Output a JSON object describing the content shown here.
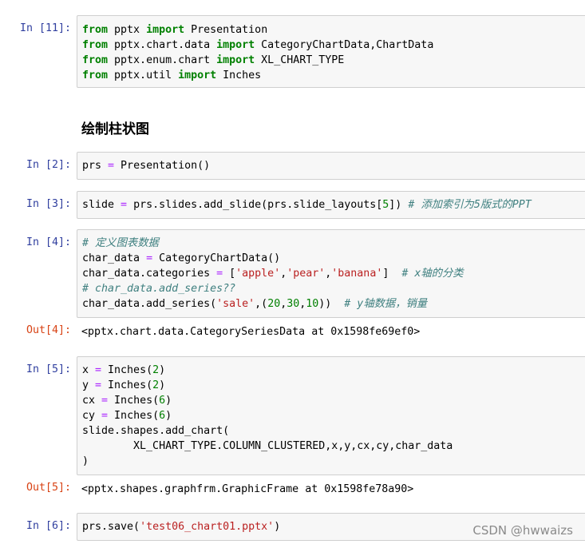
{
  "cells": {
    "c11": {
      "prompt": "In  [11]:"
    },
    "c2": {
      "prompt": "In  [2]:"
    },
    "c3": {
      "prompt": "In  [3]:"
    },
    "c4": {
      "prompt": "In  [4]:",
      "out_prompt": "Out[4]:",
      "output": "<pptx.chart.data.CategorySeriesData at 0x1598fe69ef0>"
    },
    "c5": {
      "prompt": "In  [5]:",
      "out_prompt": "Out[5]:",
      "output": "<pptx.shapes.graphfrm.GraphicFrame at 0x1598fe78a90>"
    },
    "c6": {
      "prompt": "In  [6]:"
    }
  },
  "tokens": {
    "from": "from",
    "import": "import",
    "eq": "=",
    "pptx": " pptx ",
    "Presentation": " Presentation",
    "chart_data_mod": " pptx.chart.data ",
    "CategoryChartData_ChartData": " CategoryChartData,ChartData",
    "enum_chart_mod": " pptx.enum.chart ",
    "XL_CHART_TYPE": " XL_CHART_TYPE",
    "util_mod": " pptx.util ",
    "Inches": " Inches",
    "prs": "prs ",
    "Presentation_call": " Presentation()",
    "slide": "slide ",
    "add_slide": " prs.slides.add_slide(prs.slide_layouts[",
    "five": "5",
    "close2": "]) ",
    "c3_comment": "# 添加索引为5版式的PPT",
    "c4_comment1": "# 定义图表数据",
    "char_data": "char_data ",
    "CategoryChartData_call": " CategoryChartData()",
    "char_data_categories": "char_data.categories ",
    "lbr": " [",
    "apple": "'apple'",
    "pear": "'pear'",
    "banana": "'banana'",
    "rbr": "]  ",
    "comma": ",",
    "x_comment": "# x轴的分类",
    "c4_comment2": "# char_data.add_series??",
    "add_series": "char_data.add_series(",
    "sale": "'sale'",
    "comma_lp": ",(",
    "n20": "20",
    "n30": "30",
    "n10": "10",
    "rp2": "))  ",
    "y_comment": "# y轴数据，销量",
    "x": "x ",
    "y": "y ",
    "cx": "cx ",
    "cy": "cy ",
    "inches_call": " Inches(",
    "two": "2",
    "six": "6",
    "rp": ")",
    "add_chart": "slide.shapes.add_chart(",
    "chart_args": "        XL_CHART_TYPE.COLUMN_CLUSTERED,x,y,cx,cy,char_data",
    "close_paren": ")",
    "prs_save": "prs.save(",
    "filename": "'test06_chart01.pptx'"
  },
  "heading": "绘制柱状图",
  "watermark": "CSDN @hwwaizs"
}
